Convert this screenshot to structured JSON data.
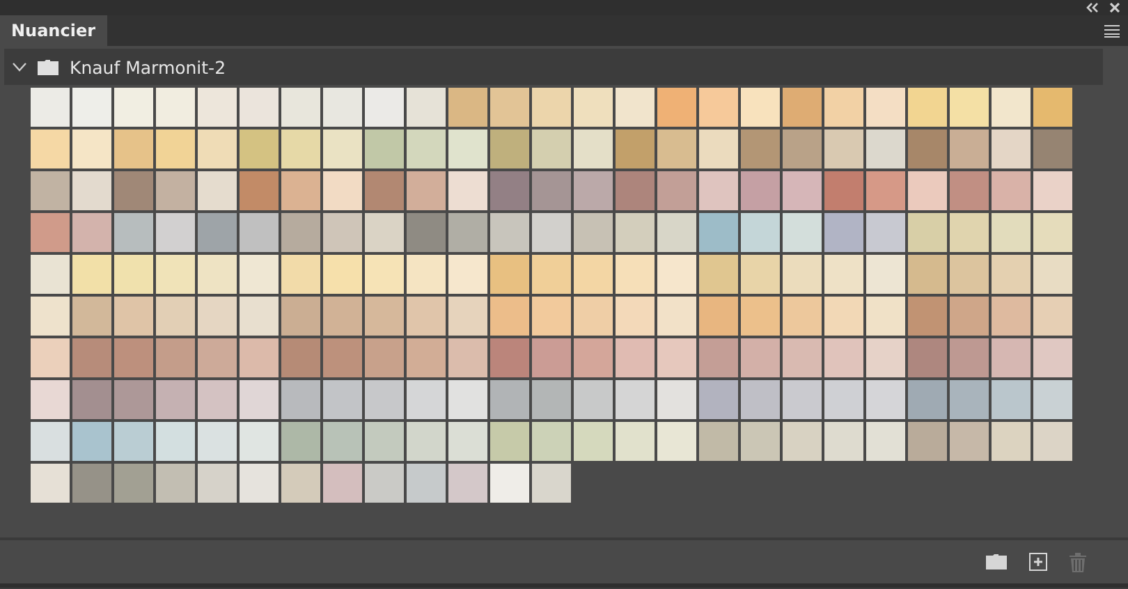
{
  "tabs": [
    {
      "label": "Nuancier",
      "selected": true
    }
  ],
  "group": {
    "name": "Knauf Marmonit-2",
    "expanded": true
  },
  "swatches": [
    {
      "color": "#ecebe6"
    },
    {
      "color": "#eeeee9"
    },
    {
      "color": "#f1eee2"
    },
    {
      "color": "#f1ede0"
    },
    {
      "color": "#ede6db"
    },
    {
      "color": "#ebe4dc"
    },
    {
      "color": "#e8e6dc"
    },
    {
      "color": "#e8e7e0"
    },
    {
      "color": "#ebeae7"
    },
    {
      "color": "#e6e2d7"
    },
    {
      "color": "#dab784"
    },
    {
      "color": "#e2c496"
    },
    {
      "color": "#ecd5ab"
    },
    {
      "color": "#efdfbd"
    },
    {
      "color": "#f1e4cc"
    },
    {
      "color": "#efb175"
    },
    {
      "color": "#f6c99a"
    },
    {
      "color": "#f8e2bd"
    },
    {
      "color": "#deac73"
    },
    {
      "color": "#f2d1a5"
    },
    {
      "color": "#f4dec4"
    },
    {
      "color": "#f2d591"
    },
    {
      "color": "#f4e0a5"
    },
    {
      "color": "#f2e6cc"
    },
    {
      "color": "#e5b96e"
    },
    {
      "color": "#f5d8a5"
    },
    {
      "color": "#f5e5c6"
    },
    {
      "color": "#e6c289"
    },
    {
      "color": "#f1d396"
    },
    {
      "color": "#efdcb6"
    },
    {
      "color": "#d4c282"
    },
    {
      "color": "#e6d9a7"
    },
    {
      "color": "#eae2c3"
    },
    {
      "color": "#c1c8a7"
    },
    {
      "color": "#d3d7bc"
    },
    {
      "color": "#e0e3cd"
    },
    {
      "color": "#bfb07d"
    },
    {
      "color": "#d4cfaf"
    },
    {
      "color": "#e4dfc8"
    },
    {
      "color": "#c2a06a"
    },
    {
      "color": "#d8bc90"
    },
    {
      "color": "#ebdbbe"
    },
    {
      "color": "#b39675"
    },
    {
      "color": "#b9a288"
    },
    {
      "color": "#d9c9b1"
    },
    {
      "color": "#dcd8cd"
    },
    {
      "color": "#a78769"
    },
    {
      "color": "#c9ae95"
    },
    {
      "color": "#e4d6c6"
    },
    {
      "color": "#968472"
    },
    {
      "color": "#c1b3a3"
    },
    {
      "color": "#e3dace"
    },
    {
      "color": "#a08877"
    },
    {
      "color": "#c3b1a1"
    },
    {
      "color": "#e5dcce"
    },
    {
      "color": "#c28b67"
    },
    {
      "color": "#dbb292"
    },
    {
      "color": "#f2dbc4"
    },
    {
      "color": "#b28872"
    },
    {
      "color": "#d2ae9a"
    },
    {
      "color": "#edddd2"
    },
    {
      "color": "#938085"
    },
    {
      "color": "#a59595"
    },
    {
      "color": "#bba9a9"
    },
    {
      "color": "#ad857c"
    },
    {
      "color": "#c29f97"
    },
    {
      "color": "#dfc4bf"
    },
    {
      "color": "#c5a0a4"
    },
    {
      "color": "#d6b6b8"
    },
    {
      "color": "#c27e6e"
    },
    {
      "color": "#d69987"
    },
    {
      "color": "#ebcabd"
    },
    {
      "color": "#c18f83"
    },
    {
      "color": "#d9b2a8"
    },
    {
      "color": "#ead2c8"
    },
    {
      "color": "#d09b8a"
    },
    {
      "color": "#d3b3ac"
    },
    {
      "color": "#b7bdbe"
    },
    {
      "color": "#d2d0d0"
    },
    {
      "color": "#9ea4a8"
    },
    {
      "color": "#c0c0c0"
    },
    {
      "color": "#b6ab9e"
    },
    {
      "color": "#cfc5b8"
    },
    {
      "color": "#dad3c5"
    },
    {
      "color": "#8f8b83"
    },
    {
      "color": "#b0aea5"
    },
    {
      "color": "#c8c5bc"
    },
    {
      "color": "#d2d0cc"
    },
    {
      "color": "#c7c1b4"
    },
    {
      "color": "#d3cebc"
    },
    {
      "color": "#d8d6c8"
    },
    {
      "color": "#9dbcc8"
    },
    {
      "color": "#c4d6d8"
    },
    {
      "color": "#d3dedb"
    },
    {
      "color": "#b1b4c5"
    },
    {
      "color": "#c8c9d1"
    },
    {
      "color": "#d8cfa7"
    },
    {
      "color": "#e0d4ae"
    },
    {
      "color": "#e2dcbc"
    },
    {
      "color": "#e5dcbb"
    },
    {
      "color": "#e9e3d3"
    },
    {
      "color": "#f2e0a8"
    },
    {
      "color": "#f0e1ad"
    },
    {
      "color": "#f0e3b8"
    },
    {
      "color": "#eee3c3"
    },
    {
      "color": "#efe7d3"
    },
    {
      "color": "#f2dba9"
    },
    {
      "color": "#f6e0ab"
    },
    {
      "color": "#f6e3b6"
    },
    {
      "color": "#f5e4c2"
    },
    {
      "color": "#f6e7cd"
    },
    {
      "color": "#e8c081"
    },
    {
      "color": "#f0cf98"
    },
    {
      "color": "#f3d6a4"
    },
    {
      "color": "#f6dfb8"
    },
    {
      "color": "#f6e6cc"
    },
    {
      "color": "#e0c690"
    },
    {
      "color": "#e8d4a8"
    },
    {
      "color": "#ebdcbc"
    },
    {
      "color": "#eee1c6"
    },
    {
      "color": "#ede5d3"
    },
    {
      "color": "#d5ba8e"
    },
    {
      "color": "#dcc49e"
    },
    {
      "color": "#e4d0b0"
    },
    {
      "color": "#e8dcc3"
    },
    {
      "color": "#eee2cc"
    },
    {
      "color": "#d2b89a"
    },
    {
      "color": "#dfc4a7"
    },
    {
      "color": "#e2cfb5"
    },
    {
      "color": "#e5d6c2"
    },
    {
      "color": "#e8dfcf"
    },
    {
      "color": "#cbae93"
    },
    {
      "color": "#d1b296"
    },
    {
      "color": "#d6b89b"
    },
    {
      "color": "#e0c5aa"
    },
    {
      "color": "#e6d3bc"
    },
    {
      "color": "#ecbd8a"
    },
    {
      "color": "#f2ca9c"
    },
    {
      "color": "#efcea6"
    },
    {
      "color": "#f3d9b9"
    },
    {
      "color": "#f2e1c8"
    },
    {
      "color": "#e8b680"
    },
    {
      "color": "#ecc08b"
    },
    {
      "color": "#edc89c"
    },
    {
      "color": "#f2d8b6"
    },
    {
      "color": "#f0e1c7"
    },
    {
      "color": "#c19373"
    },
    {
      "color": "#cfa689"
    },
    {
      "color": "#deba9f"
    },
    {
      "color": "#e6cfb4"
    },
    {
      "color": "#ebd0bb"
    },
    {
      "color": "#b78c7a"
    },
    {
      "color": "#bd907d"
    },
    {
      "color": "#c49d8a"
    },
    {
      "color": "#cdaa99"
    },
    {
      "color": "#dcbaaa"
    },
    {
      "color": "#b68b76"
    },
    {
      "color": "#bd917c"
    },
    {
      "color": "#c8a18b"
    },
    {
      "color": "#d2ad96"
    },
    {
      "color": "#dbbcac"
    },
    {
      "color": "#bb857b"
    },
    {
      "color": "#cb9c95"
    },
    {
      "color": "#d4a69a"
    },
    {
      "color": "#e0bbb2"
    },
    {
      "color": "#e6c8bd"
    },
    {
      "color": "#c49e96"
    },
    {
      "color": "#d3b0a8"
    },
    {
      "color": "#d9bab1"
    },
    {
      "color": "#e0c3bb"
    },
    {
      "color": "#e6d2c8"
    },
    {
      "color": "#ae877f"
    },
    {
      "color": "#be9992"
    },
    {
      "color": "#d6b7b2"
    },
    {
      "color": "#e0c8c2"
    },
    {
      "color": "#e8d8d4"
    },
    {
      "color": "#a38f90"
    },
    {
      "color": "#ad9898"
    },
    {
      "color": "#c5b1b2"
    },
    {
      "color": "#d4c2c2"
    },
    {
      "color": "#e0d6d6"
    },
    {
      "color": "#b8babd"
    },
    {
      "color": "#c2c4c7"
    },
    {
      "color": "#c7c8ca"
    },
    {
      "color": "#d5d6d7"
    },
    {
      "color": "#e1e1e0"
    },
    {
      "color": "#b1b4b6"
    },
    {
      "color": "#b3b6b6"
    },
    {
      "color": "#c8c9c9"
    },
    {
      "color": "#d5d5d5"
    },
    {
      "color": "#e3e1de"
    },
    {
      "color": "#b2b3bf"
    },
    {
      "color": "#bfbfc6"
    },
    {
      "color": "#cacacf"
    },
    {
      "color": "#cfd0d4"
    },
    {
      "color": "#d5d5d8"
    },
    {
      "color": "#9faab3"
    },
    {
      "color": "#a9b4bc"
    },
    {
      "color": "#bac6cc"
    },
    {
      "color": "#c9d1d4"
    },
    {
      "color": "#d9dfe0"
    },
    {
      "color": "#a9c3ce"
    },
    {
      "color": "#bacdd3"
    },
    {
      "color": "#d3dfe0"
    },
    {
      "color": "#dae1e1"
    },
    {
      "color": "#e0e5e2"
    },
    {
      "color": "#adb8a7"
    },
    {
      "color": "#b8c2b7"
    },
    {
      "color": "#c3cabe"
    },
    {
      "color": "#d2d6cb"
    },
    {
      "color": "#dbded5"
    },
    {
      "color": "#c6caa9"
    },
    {
      "color": "#ccd2b7"
    },
    {
      "color": "#d5d9bd"
    },
    {
      "color": "#e1e1cc"
    },
    {
      "color": "#e8e6d5"
    },
    {
      "color": "#c1baa7"
    },
    {
      "color": "#cbc6b5"
    },
    {
      "color": "#d8d2c2"
    },
    {
      "color": "#dedbcf"
    },
    {
      "color": "#e2e0d5"
    },
    {
      "color": "#b9ab9a"
    },
    {
      "color": "#c6b8a8"
    },
    {
      "color": "#dcd3c0"
    },
    {
      "color": "#dcd4c6"
    },
    {
      "color": "#e6e0d6"
    },
    {
      "color": "#969288"
    },
    {
      "color": "#a2a093"
    },
    {
      "color": "#c2beb2"
    },
    {
      "color": "#d6d2c9"
    },
    {
      "color": "#e6e3dd"
    },
    {
      "color": "#d4cbba"
    },
    {
      "color": "#d4bebe"
    },
    {
      "color": "#cacac6"
    },
    {
      "color": "#c6cacb"
    },
    {
      "color": "#d4c8c9"
    },
    {
      "color": "#efede8"
    },
    {
      "color": "#d9d6cc"
    }
  ],
  "footer_buttons": [
    {
      "kind": "folder",
      "disabled": false
    },
    {
      "kind": "new",
      "disabled": false
    },
    {
      "kind": "delete",
      "disabled": true
    }
  ]
}
